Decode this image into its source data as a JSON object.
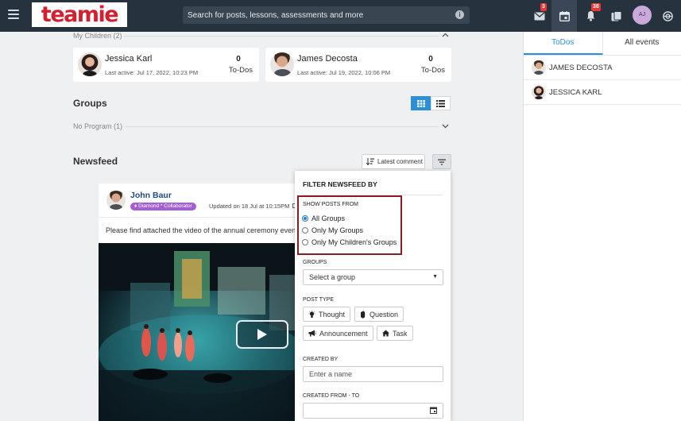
{
  "topbar": {
    "logo_text": "teamie",
    "search_placeholder": "Search for posts, lessons, assessments and more",
    "info_icon": "i",
    "mail_badge": "3",
    "notif_badge": "38",
    "avatar_initials": "AJ"
  },
  "children_section": {
    "label": "My Children (2)",
    "children": [
      {
        "name": "Jessica Karl",
        "last_active": "Last active: Jul 17, 2022, 10:23 PM",
        "todo_count": "0",
        "todo_label": "To-Dos"
      },
      {
        "name": "James Decosta",
        "last_active": "Last active: Jul 19, 2022, 10:06 PM",
        "todo_count": "0",
        "todo_label": "To-Dos"
      }
    ]
  },
  "groups_section": {
    "title": "Groups",
    "program_label": "No Program (1)"
  },
  "newsfeed": {
    "title": "Newsfeed",
    "sort_label": "Latest comment"
  },
  "post": {
    "author": "John Baur",
    "badge": "Diamond * Collaborator",
    "updated": "Updated on 18 Jul at 10:15PM",
    "text": "Please find attached the video of the annual ceremony event"
  },
  "filter_panel": {
    "title": "FILTER NEWSFEED BY",
    "show_posts_label": "SHOW POSTS FROM",
    "options": [
      "All Groups",
      "Only My Groups",
      "Only My Children's Groups"
    ],
    "selected_option": "All Groups",
    "groups_label": "GROUPS",
    "group_select_value": "Select a group",
    "post_type_label": "POST TYPE",
    "post_types": [
      "Thought",
      "Question",
      "Announcement",
      "Task"
    ],
    "created_by_label": "CREATED BY",
    "created_by_placeholder": "Enter a name",
    "created_from_label": "CREATED FROM - TO"
  },
  "right_panel": {
    "tabs": [
      "ToDos",
      "All events"
    ],
    "active_tab": "ToDos",
    "people": [
      "JAMES DECOSTA",
      "JESSICA KARL"
    ]
  },
  "colors": {
    "topbar": "#27323f",
    "accent_blue": "#2c8fd8",
    "logo_red": "#d1202f",
    "highlight_border": "#8a1c24",
    "badge_purple": "#a35fd3"
  },
  "icons": [
    "menu-icon",
    "info-icon",
    "mail-icon",
    "calendar-icon",
    "bell-icon",
    "book-icon",
    "globe-icon",
    "chevron-up-icon",
    "chevron-down-icon",
    "grid-view-icon",
    "list-view-icon",
    "sort-icon",
    "filter-icon",
    "external-link-icon",
    "play-icon",
    "lightbulb-icon",
    "hand-icon",
    "megaphone-icon",
    "house-icon",
    "calendar-small-icon"
  ]
}
